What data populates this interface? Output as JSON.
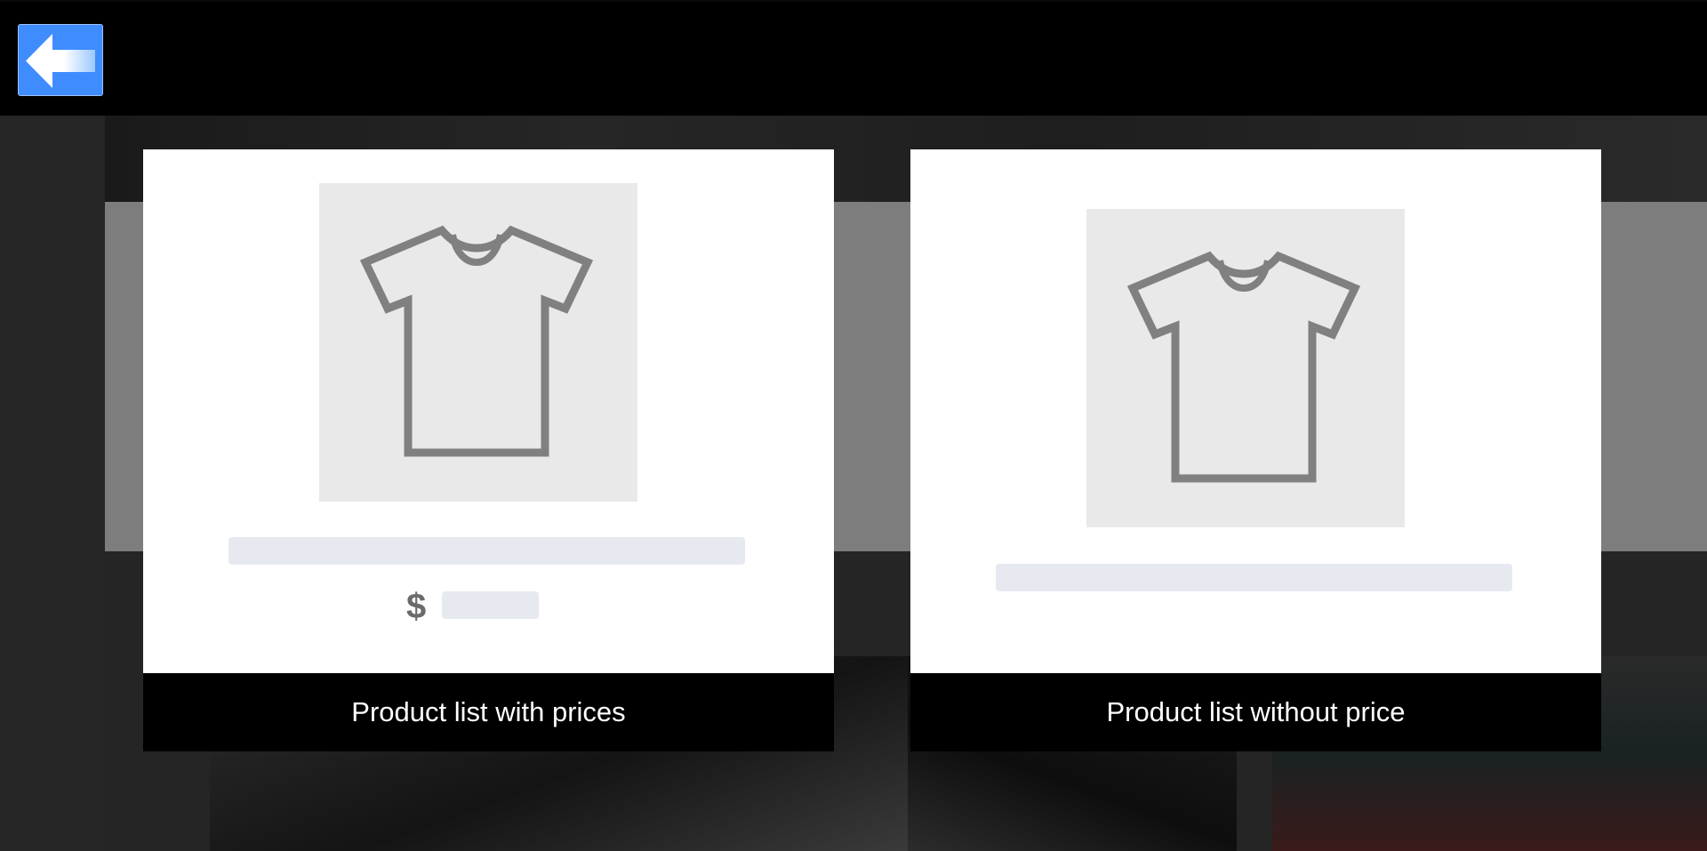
{
  "toolbar": {
    "back_icon": "arrow-left-icon",
    "accent_color": "#3f8cff"
  },
  "options": [
    {
      "label": "Product list with prices",
      "icon": "tshirt-icon",
      "currency_symbol": "$"
    },
    {
      "label": "Product list without price",
      "icon": "tshirt-icon"
    }
  ]
}
